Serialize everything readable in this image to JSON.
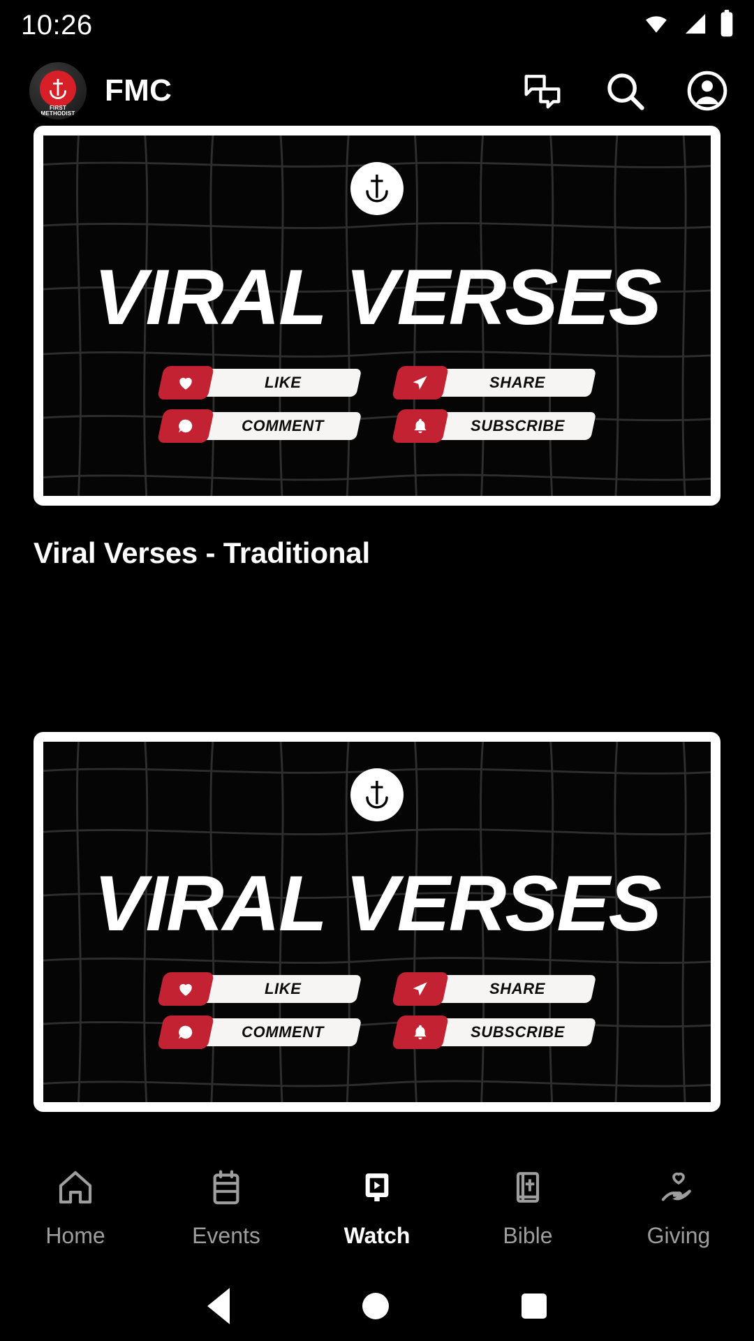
{
  "status_bar": {
    "time": "10:26",
    "icons": [
      "wifi-icon",
      "cellular-signal-icon",
      "battery-icon"
    ]
  },
  "app_bar": {
    "logo": {
      "icon": "anchor-cross-icon",
      "caption_line1": "FIRST",
      "caption_line2": "METHODIST",
      "disc_color": "#D61F26"
    },
    "title": "FMC",
    "actions": [
      {
        "name": "chat-icon",
        "label": "Chat"
      },
      {
        "name": "search-icon",
        "label": "Search"
      },
      {
        "name": "account-icon",
        "label": "Account"
      }
    ]
  },
  "feed": {
    "items": [
      {
        "title": "Viral Verses - Traditional",
        "thumbnail": {
          "badge_icon": "anchor-cross-icon",
          "headline": "VIRAL VERSES",
          "buttons": [
            {
              "icon": "heart-icon",
              "label": "LIKE"
            },
            {
              "icon": "send-icon",
              "label": "SHARE"
            },
            {
              "icon": "comment-icon",
              "label": "COMMENT"
            },
            {
              "icon": "bell-icon",
              "label": "SUBSCRIBE"
            }
          ],
          "accent_color": "#C32232"
        }
      },
      {
        "title": "",
        "thumbnail": {
          "badge_icon": "anchor-cross-icon",
          "headline": "VIRAL VERSES",
          "buttons": [
            {
              "icon": "heart-icon",
              "label": "LIKE"
            },
            {
              "icon": "send-icon",
              "label": "SHARE"
            },
            {
              "icon": "comment-icon",
              "label": "COMMENT"
            },
            {
              "icon": "bell-icon",
              "label": "SUBSCRIBE"
            }
          ],
          "accent_color": "#C32232"
        }
      }
    ]
  },
  "bottom_nav": {
    "active": "Watch",
    "items": [
      {
        "label": "Home",
        "icon": "home-icon"
      },
      {
        "label": "Events",
        "icon": "calendar-icon"
      },
      {
        "label": "Watch",
        "icon": "video-player-icon"
      },
      {
        "label": "Bible",
        "icon": "bible-book-icon"
      },
      {
        "label": "Giving",
        "icon": "hand-heart-icon"
      }
    ]
  },
  "system_nav": {
    "items": [
      {
        "name": "back-button",
        "icon": "triangle-back-icon"
      },
      {
        "name": "home-button",
        "icon": "circle-home-icon"
      },
      {
        "name": "recents-button",
        "icon": "square-recents-icon"
      }
    ]
  }
}
